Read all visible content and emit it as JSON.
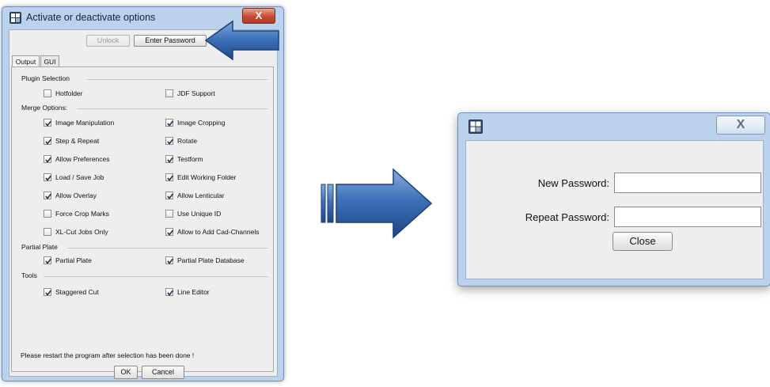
{
  "dialog1": {
    "title": "Activate or deactivate options",
    "close_label": "X",
    "unlock_label": "Unlock",
    "enter_password_label": "Enter Password",
    "tabs": [
      {
        "label": "Output"
      },
      {
        "label": "GUI"
      }
    ],
    "sections": {
      "plugin": "Plugin Selection",
      "merge": "Merge Options:",
      "partial": "Partial Plate",
      "tools": "Tools"
    },
    "options": {
      "hotfolder": {
        "label": "Hotfolder",
        "checked": false
      },
      "jdf_support": {
        "label": "JDF Support",
        "checked": false
      },
      "image_manipulation": {
        "label": "Image Manipulation",
        "checked": true
      },
      "image_cropping": {
        "label": "Image Cropping",
        "checked": true
      },
      "step_repeat": {
        "label": "Step & Repeat",
        "checked": true
      },
      "rotate": {
        "label": "Rotate",
        "checked": true
      },
      "allow_preferences": {
        "label": "Allow Preferences",
        "checked": true
      },
      "testform": {
        "label": "Testform",
        "checked": true
      },
      "load_save_job": {
        "label": "Load / Save Job",
        "checked": true
      },
      "edit_working_folder": {
        "label": "Edit Working Folder",
        "checked": true
      },
      "allow_overlay": {
        "label": "Allow Overlay",
        "checked": true
      },
      "allow_lenticular": {
        "label": "Allow Lenticular",
        "checked": true
      },
      "force_crop_marks": {
        "label": "Force Crop Marks",
        "checked": false
      },
      "use_unique_id": {
        "label": "Use Unique ID",
        "checked": false
      },
      "xl_cut_jobs_only": {
        "label": "XL-Cut Jobs Only",
        "checked": false
      },
      "allow_cad_channels": {
        "label": "Allow to Add Cad-Channels",
        "checked": true
      },
      "partial_plate": {
        "label": "Partial Plate",
        "checked": true
      },
      "partial_plate_database": {
        "label": "Partial Plate Database",
        "checked": true
      },
      "staggered_cut": {
        "label": "Staggered Cut",
        "checked": true
      },
      "line_editor": {
        "label": "Line Editor",
        "checked": true
      }
    },
    "note": "Please restart the program after selection has been done !",
    "ok_label": "OK",
    "cancel_label": "Cancel"
  },
  "dialog2": {
    "close_label": "X",
    "new_password_label": "New Password:",
    "repeat_password_label": "Repeat Password:",
    "new_password_value": "",
    "repeat_password_value": "",
    "close_button_label": "Close"
  },
  "colors": {
    "window_frame": "#bcd2ec",
    "client_bg": "#eeeeee",
    "arrow_blue": "#3c6db4",
    "close_red": "#c64a32"
  }
}
